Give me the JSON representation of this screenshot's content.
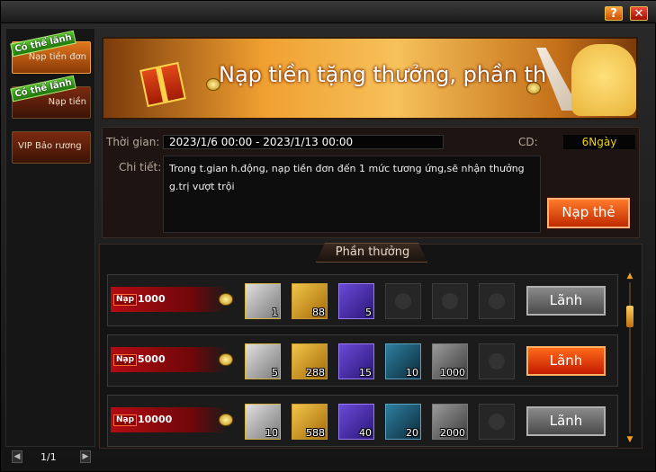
{
  "window": {
    "help_label": "?",
    "close_label": "✕"
  },
  "sidebar": {
    "items": [
      {
        "label": "Nạp tiền đơn",
        "badge": "Có thể lãnh"
      },
      {
        "label": "Nạp tiền",
        "badge": "Có thể lãnh"
      },
      {
        "label": "VIP Bảo rương",
        "badge": ""
      }
    ],
    "pager": {
      "prev": "◀",
      "next": "▶",
      "text": "1/1"
    }
  },
  "banner": {
    "title": "Nạp tiền tặng thưởng, phần th"
  },
  "info": {
    "time_label": "Thời gian:",
    "time_value": "2023/1/6 00:00 - 2023/1/13 00:00",
    "cd_label": "CD:",
    "cd_value": "6Ngày",
    "detail_label": "Chi tiết:",
    "detail_value": "Trong t.gian h.động, nạp tiền đơn đến 1 mức tương ứng,sẽ nhận thưởng g.trị vượt trội",
    "topup_button": "Nạp thẻ"
  },
  "rewards": {
    "title": "Phần thưởng",
    "tier_prefix": "Nạp",
    "rows": [
      {
        "amount": "1000",
        "button": "Lãnh",
        "enabled": false,
        "items": [
          {
            "icon": "scroll-icon",
            "qty": "1"
          },
          {
            "icon": "card-icon",
            "qty": "88"
          },
          {
            "icon": "lion-gem-icon",
            "qty": "5"
          },
          {
            "icon": "empty-slot-icon",
            "qty": ""
          },
          {
            "icon": "empty-slot-icon",
            "qty": ""
          },
          {
            "icon": "empty-slot-icon",
            "qty": ""
          }
        ]
      },
      {
        "amount": "5000",
        "button": "Lãnh",
        "enabled": true,
        "items": [
          {
            "icon": "scroll-icon",
            "qty": "5"
          },
          {
            "icon": "card-icon",
            "qty": "288"
          },
          {
            "icon": "lion-gem-icon",
            "qty": "15"
          },
          {
            "icon": "mask-icon",
            "qty": "10"
          },
          {
            "icon": "stone-icon",
            "qty": "1000"
          },
          {
            "icon": "empty-slot-icon",
            "qty": ""
          }
        ]
      },
      {
        "amount": "10000",
        "button": "Lãnh",
        "enabled": false,
        "items": [
          {
            "icon": "scroll-icon",
            "qty": "10"
          },
          {
            "icon": "card-icon",
            "qty": "588"
          },
          {
            "icon": "lion-gem-icon",
            "qty": "40"
          },
          {
            "icon": "mask-icon",
            "qty": "20"
          },
          {
            "icon": "stone-icon",
            "qty": "2000"
          },
          {
            "icon": "empty-slot-icon",
            "qty": ""
          }
        ]
      }
    ]
  }
}
